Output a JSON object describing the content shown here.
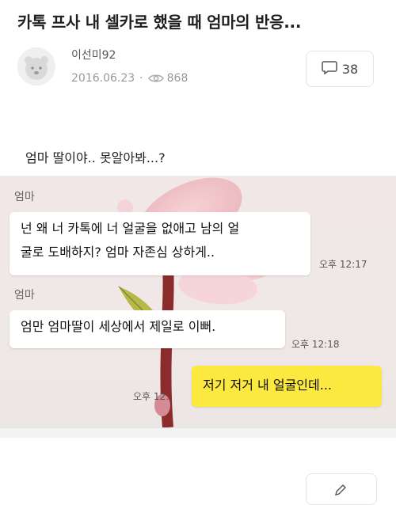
{
  "post": {
    "title": "카톡 프사 내 셀카로 했을 때 엄마의 반응...",
    "author": "이선미92",
    "date": "2016.06.23",
    "separator": "·",
    "views": "868",
    "comments": "38",
    "body": "엄마 딸이야.. 못알아봐...?"
  },
  "chat": {
    "messages": [
      {
        "sender": "엄마",
        "line1": "넌 왜 너 카톡에 너 얼굴을 없애고 남의 얼",
        "line2": "굴로 도배하지? 엄마 자존심 상하게..",
        "time": "오후 12:17"
      },
      {
        "sender": "엄마",
        "line1": "엄만 엄마딸이 세상에서 제일로 이뻐.",
        "time": "오후 12:18"
      },
      {
        "line1": "저기 저거 내 얼굴인데...",
        "time": "오후 12:"
      }
    ]
  },
  "icons": [
    "avatar-icon",
    "eye-icon",
    "comment-icon",
    "pencil-icon"
  ],
  "colors": {
    "my_bubble": "#fbe940",
    "chat_background": "#efe8e7"
  }
}
